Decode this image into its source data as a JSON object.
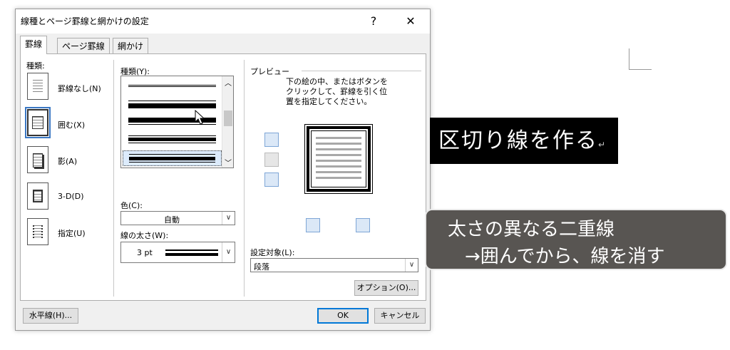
{
  "dialog": {
    "title": "線種とページ罫線と網かけの設定",
    "help_label": "?",
    "close_label": "✕",
    "tabs": [
      {
        "label": "罫線",
        "active": true
      },
      {
        "label": "ページ罫線",
        "active": false
      },
      {
        "label": "網かけ",
        "active": false
      }
    ],
    "settings": {
      "label": "種類:",
      "items": [
        {
          "label": "罫線なし(N)",
          "selected": false
        },
        {
          "label": "囲む(X)",
          "selected": true
        },
        {
          "label": "影(A)",
          "selected": false
        },
        {
          "label": "3-D(D)",
          "selected": false
        },
        {
          "label": "指定(U)",
          "selected": false
        }
      ]
    },
    "style": {
      "label": "種類(Y):",
      "scroll_up": "︿",
      "scroll_down": "﹀"
    },
    "color": {
      "label": "色(C):",
      "value": "自動"
    },
    "width": {
      "label": "線の太さ(W):",
      "value": "3 pt"
    },
    "preview": {
      "label": "プレビュー",
      "instructions": [
        "下の絵の中、またはボタンを",
        "クリックして、罫線を引く位",
        "置を指定してください。"
      ]
    },
    "apply_to": {
      "label": "設定対象(L):",
      "value": "段落"
    },
    "buttons": {
      "options": "オプション(O)...",
      "horizontal_line": "水平線(H)...",
      "ok": "OK",
      "cancel": "キャンセル"
    }
  },
  "captions": {
    "title": "区切り線を作る",
    "note_line1": "太さの異なる二重線",
    "note_line2": "→囲んでから、線を消す"
  },
  "colors": {
    "accent": "#0078d7",
    "caption_title_bg": "#000000",
    "caption_note_bg": "#585552"
  }
}
